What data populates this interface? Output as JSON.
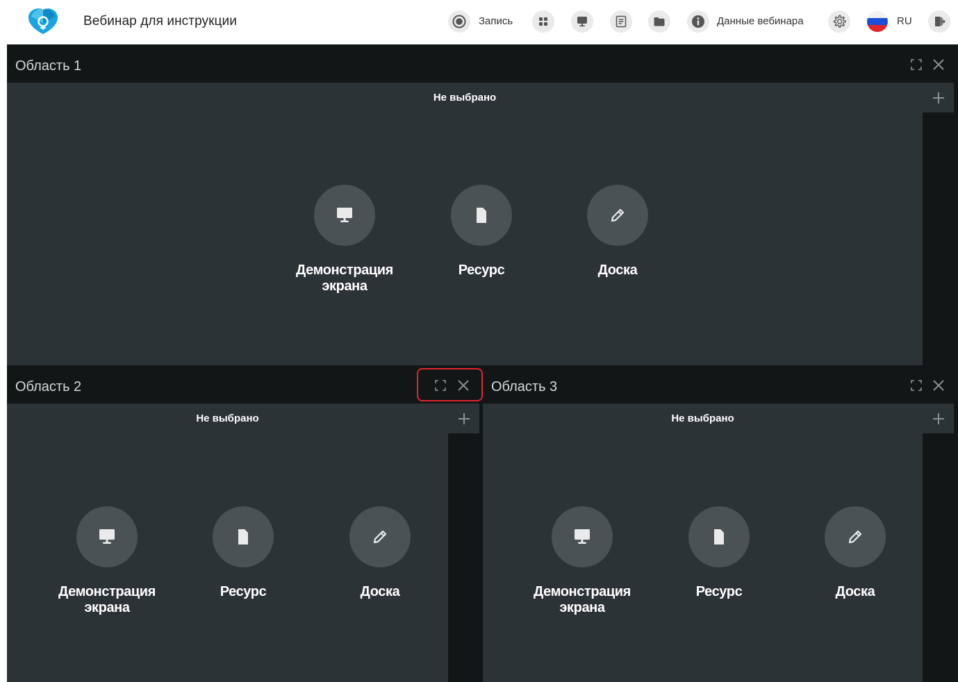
{
  "app": {
    "title": "Вебинар для инструкции"
  },
  "toolbar": {
    "record_label": "Запись",
    "webinar_data_label": "Данные вебинара",
    "language_label": "RU"
  },
  "colors": {
    "background": "#121617",
    "panel": "#2c3337",
    "option_circle": "#4a5256",
    "highlight": "#e0262d",
    "brand": "#1aa3e0"
  },
  "areas": [
    {
      "title": "Область 1",
      "status": "Не выбрано",
      "options": [
        {
          "icon": "monitor-icon",
          "label_line1": "Демонстрация",
          "label_line2": "экрана"
        },
        {
          "icon": "file-icon",
          "label_line1": "Ресурс",
          "label_line2": ""
        },
        {
          "icon": "pencil-icon",
          "label_line1": "Доска",
          "label_line2": ""
        }
      ]
    },
    {
      "title": "Область 2",
      "status": "Не выбрано",
      "options": [
        {
          "icon": "monitor-icon",
          "label_line1": "Демонстрация",
          "label_line2": "экрана"
        },
        {
          "icon": "file-icon",
          "label_line1": "Ресурс",
          "label_line2": ""
        },
        {
          "icon": "pencil-icon",
          "label_line1": "Доска",
          "label_line2": ""
        }
      ]
    },
    {
      "title": "Область 3",
      "status": "Не выбрано",
      "options": [
        {
          "icon": "monitor-icon",
          "label_line1": "Демонстрация",
          "label_line2": "экрана"
        },
        {
          "icon": "file-icon",
          "label_line1": "Ресурс",
          "label_line2": ""
        },
        {
          "icon": "pencil-icon",
          "label_line1": "Доска",
          "label_line2": ""
        }
      ]
    }
  ]
}
